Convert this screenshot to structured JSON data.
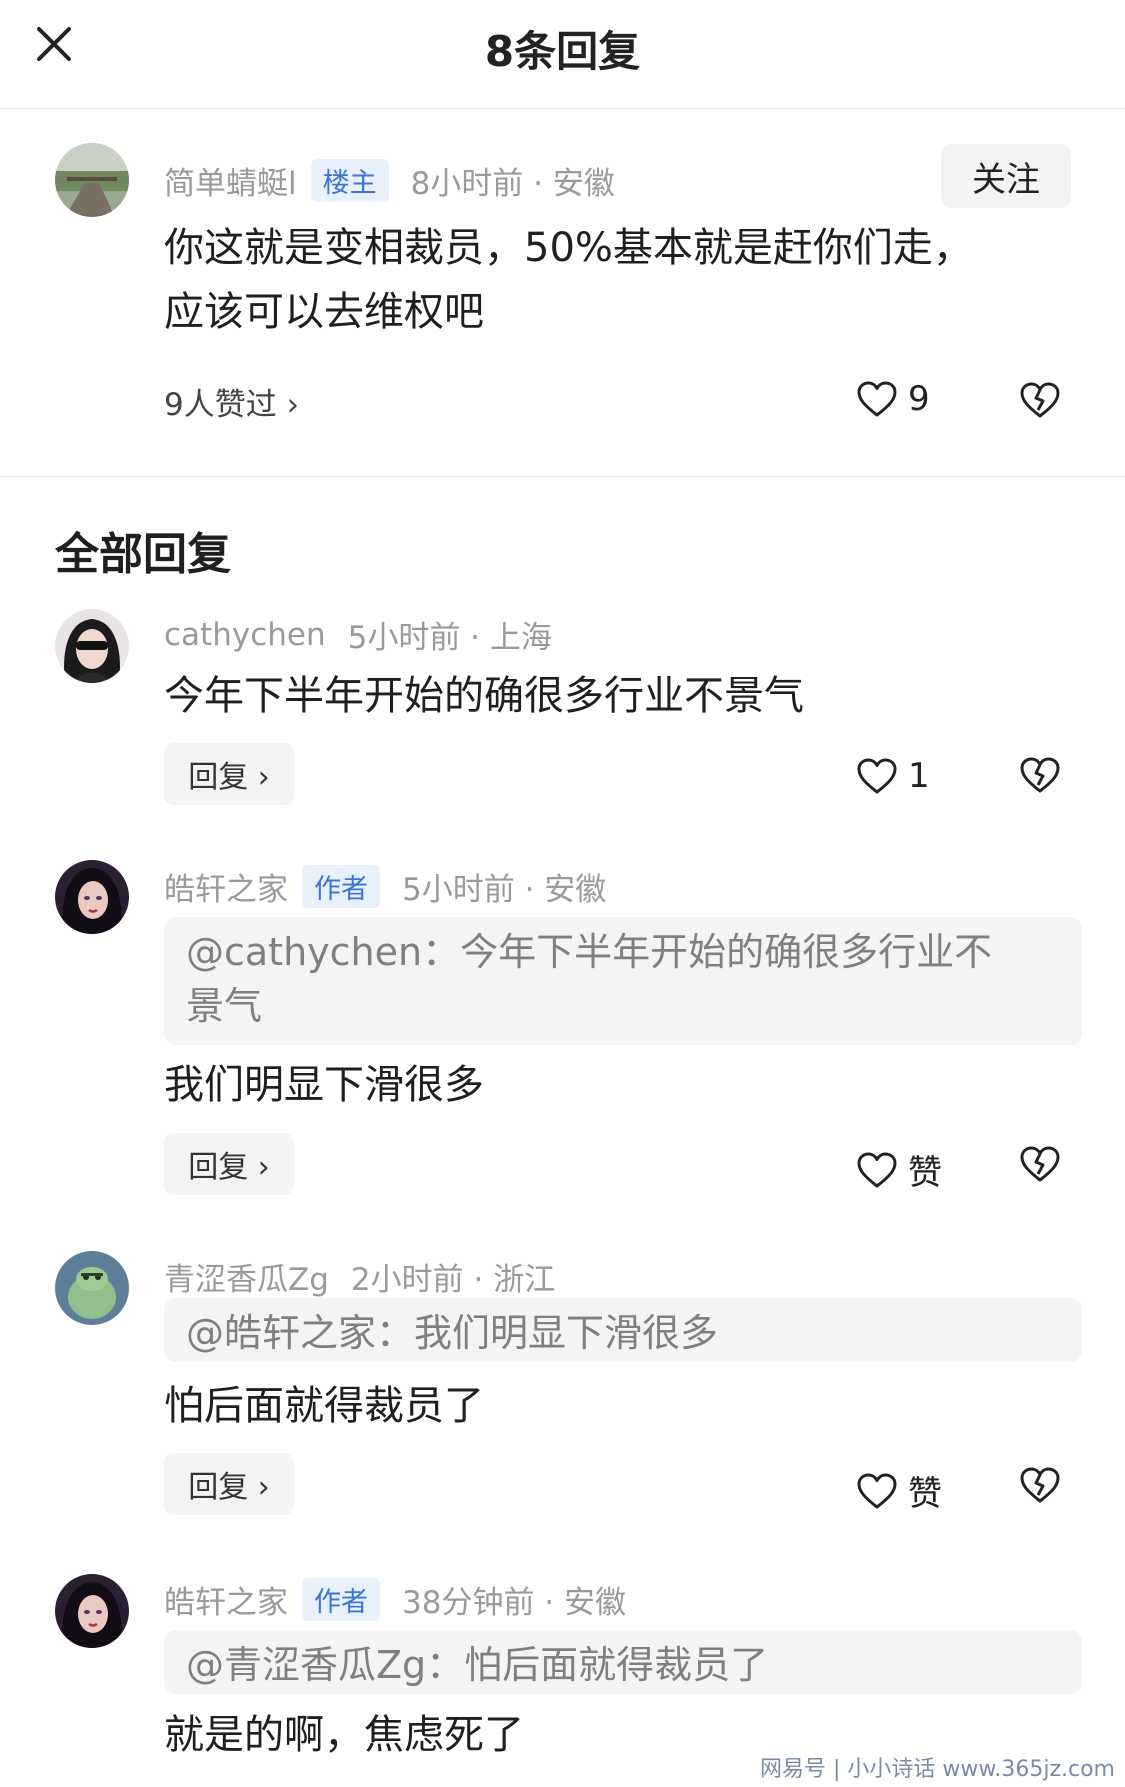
{
  "header": {
    "title": "8条回复"
  },
  "main_comment": {
    "name": "简单蜻蜓l",
    "badge": "楼主",
    "time": "8小时前 · 安徽",
    "follow": "关注",
    "text_line1": "你这就是变相裁员，50%基本就是赶你们走，",
    "text_line2": "应该可以去维权吧",
    "likers": "9人赞过 ›",
    "likes": "9"
  },
  "section_title": "全部回复",
  "replies": [
    {
      "name": "cathychen",
      "badge": "",
      "time": "5小时前 · 上海",
      "quote1": "",
      "quote2": "",
      "text": "今年下半年开始的确很多行业不景气",
      "reply_label": "回复 ›",
      "likes": "1"
    },
    {
      "name": "皓轩之家",
      "badge": "作者",
      "time": "5小时前 · 安徽",
      "quote1": "@cathychen：今年下半年开始的确很多行业不",
      "quote2": "景气",
      "text": "我们明显下滑很多",
      "reply_label": "回复 ›",
      "likes": "赞"
    },
    {
      "name": "青涩香瓜Zg",
      "badge": "",
      "time": "2小时前 · 浙江",
      "quote1": "@皓轩之家：我们明显下滑很多",
      "quote2": "",
      "text": "怕后面就得裁员了",
      "reply_label": "回复 ›",
      "likes": "赞"
    },
    {
      "name": "皓轩之家",
      "badge": "作者",
      "time": "38分钟前 · 安徽",
      "quote1": "@青涩香瓜Zg：怕后面就得裁员了",
      "quote2": "",
      "text": "就是的啊，焦虑死了"
    }
  ],
  "watermark": "网易号 | 小小诗话 www.365jz.com",
  "icons": {
    "close": "close-icon",
    "heart": "heart-icon",
    "broken_heart": "broken-heart-icon"
  }
}
